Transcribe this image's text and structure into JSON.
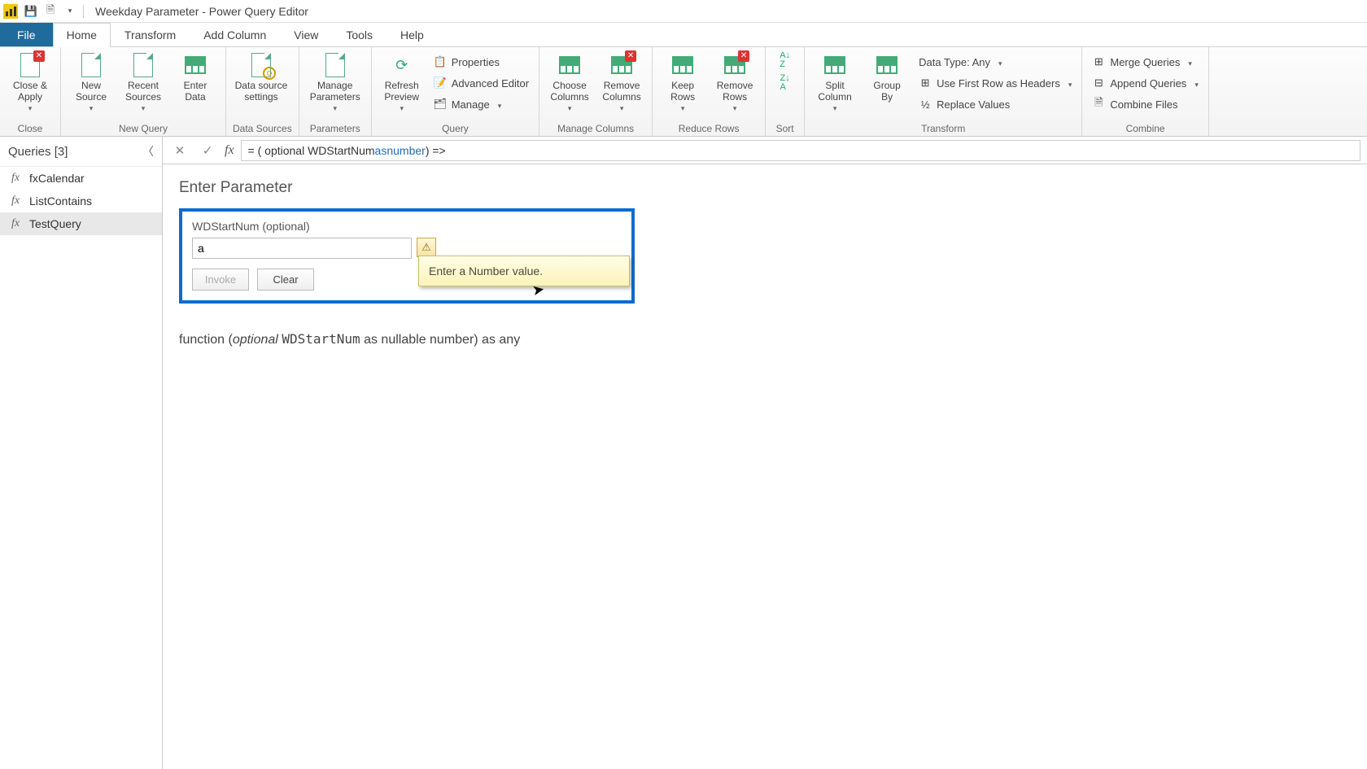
{
  "titlebar": {
    "title": "Weekday Parameter - Power Query Editor"
  },
  "tabs": {
    "file": "File",
    "home": "Home",
    "transform": "Transform",
    "addcol": "Add Column",
    "view": "View",
    "tools": "Tools",
    "help": "Help"
  },
  "ribbon": {
    "close": {
      "close_apply": "Close &\nApply",
      "group": "Close"
    },
    "newquery": {
      "new_source": "New\nSource",
      "recent_sources": "Recent\nSources",
      "enter_data": "Enter\nData",
      "group": "New Query"
    },
    "datasources": {
      "settings": "Data source\nsettings",
      "group": "Data Sources"
    },
    "parameters": {
      "manage": "Manage\nParameters",
      "group": "Parameters"
    },
    "query": {
      "refresh": "Refresh\nPreview",
      "properties": "Properties",
      "adv": "Advanced Editor",
      "manage": "Manage",
      "group": "Query"
    },
    "managecols": {
      "choose": "Choose\nColumns",
      "remove": "Remove\nColumns",
      "group": "Manage Columns"
    },
    "reducerows": {
      "keep": "Keep\nRows",
      "remove": "Remove\nRows",
      "group": "Reduce Rows"
    },
    "sort": {
      "group": "Sort"
    },
    "transform": {
      "split": "Split\nColumn",
      "group_by": "Group\nBy",
      "datatype": "Data Type: Any",
      "firstrow": "Use First Row as Headers",
      "replace": "Replace Values",
      "group": "Transform"
    },
    "combine": {
      "merge": "Merge Queries",
      "append": "Append Queries",
      "combine_files": "Combine Files",
      "group": "Combine"
    }
  },
  "sidebar": {
    "header": "Queries [3]",
    "items": [
      {
        "name": "fxCalendar"
      },
      {
        "name": "ListContains"
      },
      {
        "name": "TestQuery"
      }
    ]
  },
  "formula": {
    "prefix": "= ( optional WDStartNum ",
    "kw1": "as",
    "mid": " ",
    "kw2": "number",
    "suffix": ") =>"
  },
  "param": {
    "title": "Enter Parameter",
    "label": "WDStartNum (optional)",
    "value": "a",
    "invoke": "Invoke",
    "clear": "Clear",
    "tooltip": "Enter a Number value."
  },
  "signature": {
    "pre": "function (",
    "opt": "optional",
    "name": "WDStartNum",
    "post": " as nullable number) as any"
  }
}
